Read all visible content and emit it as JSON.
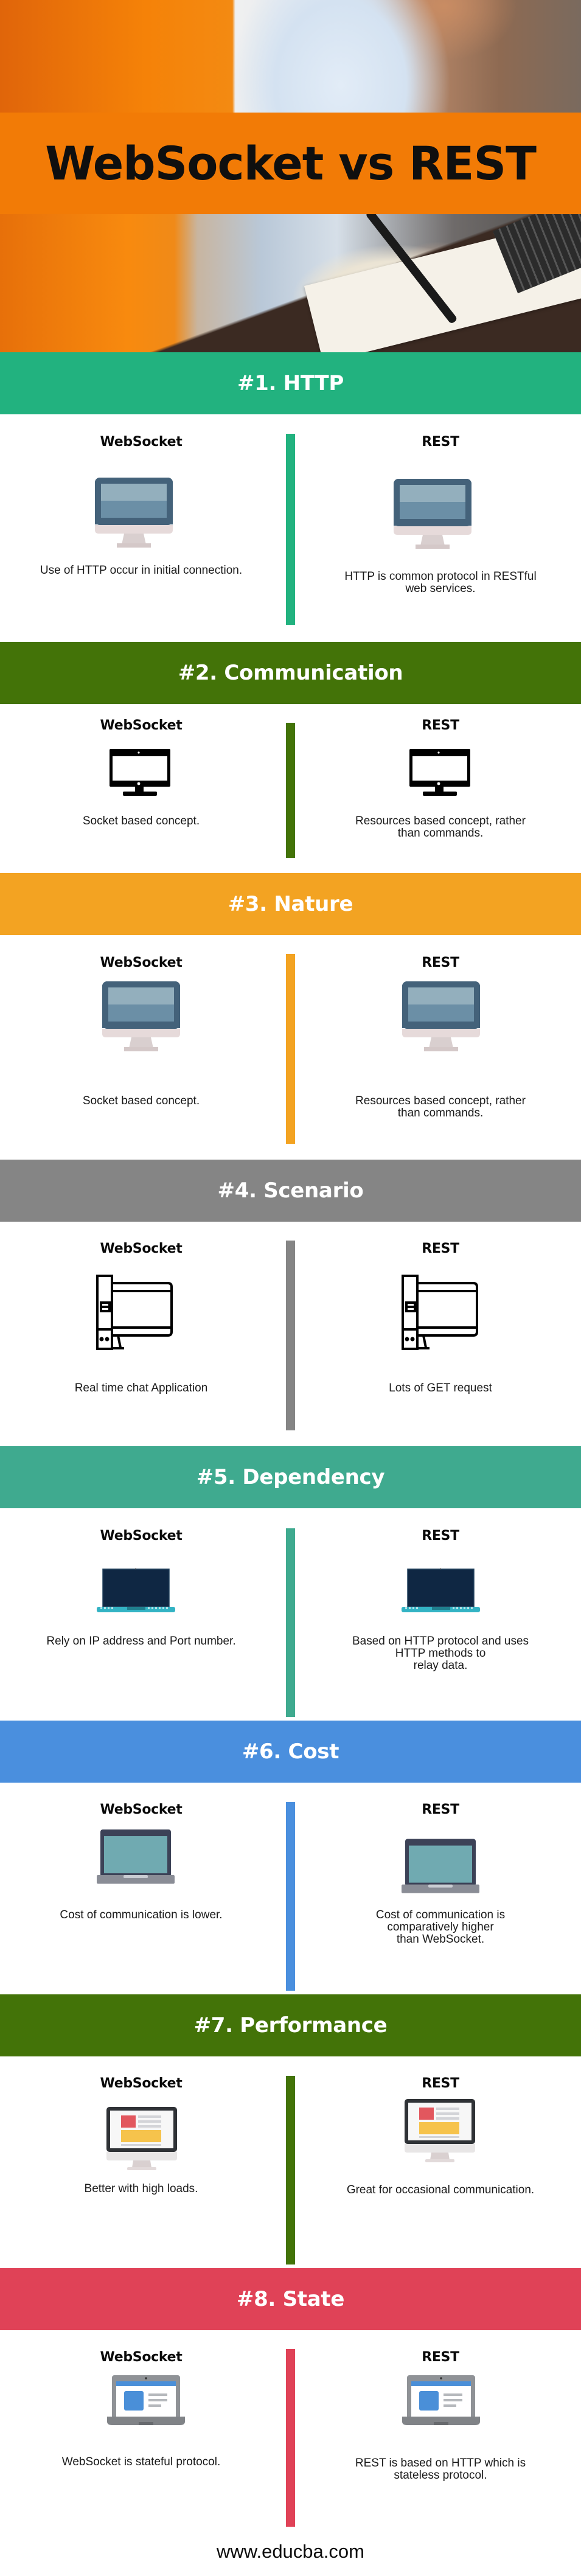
{
  "title": "WebSocket vs REST",
  "footer": "www.educba.com",
  "column_labels": {
    "left": "WebSocket",
    "right": "REST"
  },
  "sections": [
    {
      "heading": "#1. HTTP",
      "color": "#22b27f",
      "icon": "monitor-flat-icon",
      "websocket": "Use of HTTP occur in initial connection.",
      "rest": [
        "HTTP is common protocol in RESTful",
        "web services."
      ]
    },
    {
      "heading": "#2. Communication",
      "color": "#437308",
      "icon": "monitor-outline-black-icon",
      "websocket": "Socket based concept.",
      "rest": [
        "Resources based concept, rather",
        "than commands."
      ]
    },
    {
      "heading": "#3. Nature",
      "color": "#f3a322",
      "icon": "monitor-flat-icon",
      "websocket": "Socket based concept.",
      "rest": [
        "Resources based concept, rather",
        "than commands."
      ]
    },
    {
      "heading": "#4. Scenario",
      "color": "#858585",
      "icon": "desktop-tower-outline-icon",
      "websocket": "Real time chat Application",
      "rest": [
        "Lots of GET request"
      ]
    },
    {
      "heading": "#5. Dependency",
      "color": "#3faa8f",
      "icon": "laptop-dark-icon",
      "websocket": "Rely on IP address and Port number.",
      "rest": [
        "Based on HTTP protocol and uses",
        "HTTP methods to",
        "relay data."
      ]
    },
    {
      "heading": "#6. Cost",
      "color": "#4a8fde",
      "icon": "laptop-teal-icon",
      "websocket": "Cost of communication is lower.",
      "rest": [
        "Cost of communication is",
        "comparatively higher",
        "than WebSocket."
      ]
    },
    {
      "heading": "#7. Performance",
      "color": "#437308",
      "icon": "monitor-webpage-icon",
      "websocket": "Better with high loads.",
      "rest": [
        "Great for occasional communication."
      ]
    },
    {
      "heading": "#8. State",
      "color": "#e04257",
      "icon": "laptop-webpage-icon",
      "websocket": "WebSocket is stateful protocol.",
      "rest": [
        "REST is based on HTTP which is",
        "stateless protocol."
      ]
    }
  ]
}
